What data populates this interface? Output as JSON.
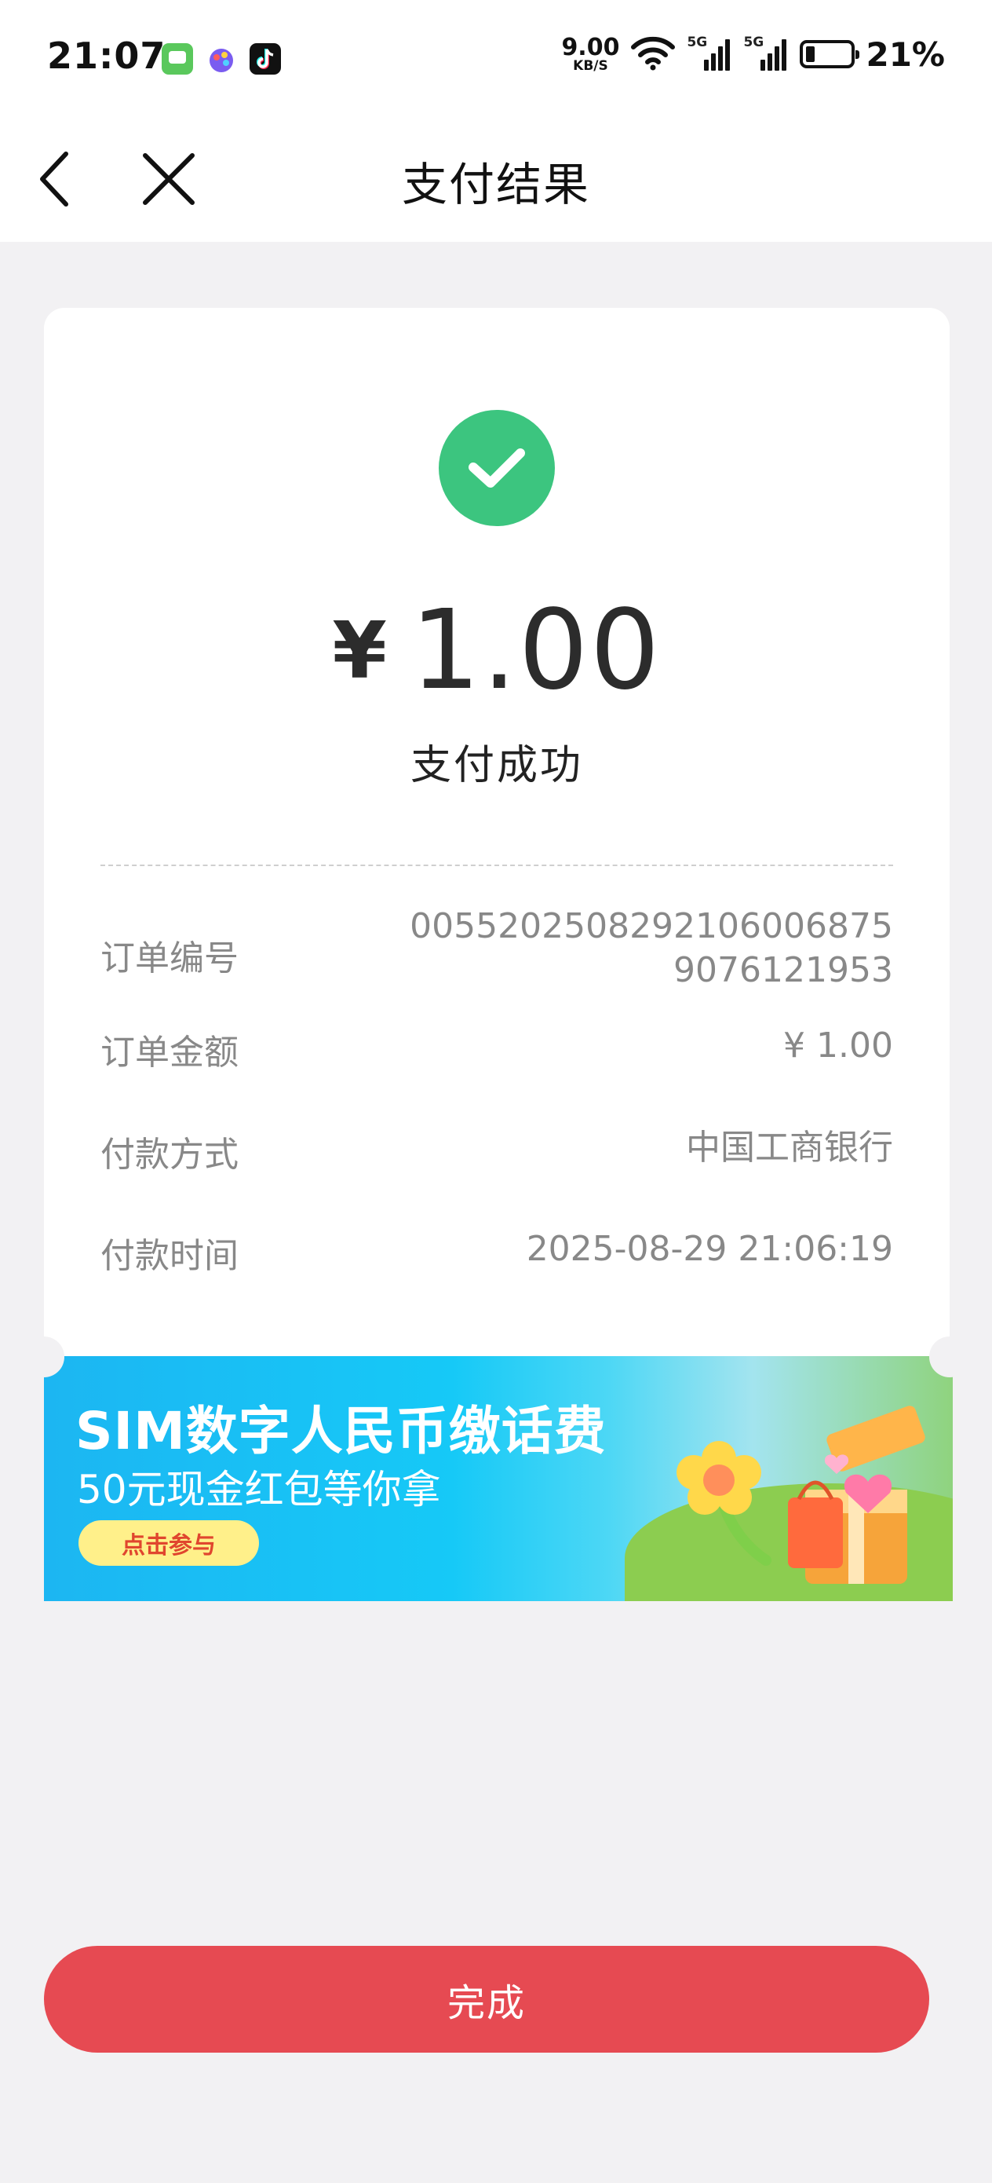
{
  "status_bar": {
    "time": "21:07",
    "net_speed_value": "9.00",
    "net_speed_unit": "KB/S",
    "sim1_label": "5G",
    "sim2_label": "5G",
    "battery_percent": "21%",
    "battery_level": 0.21,
    "icons": [
      "messages-app-icon",
      "paint-app-icon",
      "tiktok-app-icon",
      "wifi-icon",
      "signal-icon",
      "signal-icon",
      "battery-icon"
    ]
  },
  "nav": {
    "title": "支付结果",
    "back_icon": "chevron-left-icon",
    "close_icon": "close-icon"
  },
  "result": {
    "currency": "¥",
    "amount": "1.00",
    "status": "支付成功",
    "status_color": "#3cc57f"
  },
  "details": [
    {
      "label": "订单编号",
      "value_line1": "00552025082921060068​75",
      "value_line2": "9076121953"
    },
    {
      "label": "订单金额",
      "value": "¥ 1.00"
    },
    {
      "label": "付款方式",
      "value": "中国工商银行"
    },
    {
      "label": "付款时间",
      "value": "2025-08-29 21:06:19"
    }
  ],
  "banner": {
    "title": "SIM数字人民币缴话费",
    "subtitle": "50元现金红包等你拿",
    "cta": "点击参与"
  },
  "footer": {
    "done_label": "完成",
    "button_color": "#e64a52"
  }
}
